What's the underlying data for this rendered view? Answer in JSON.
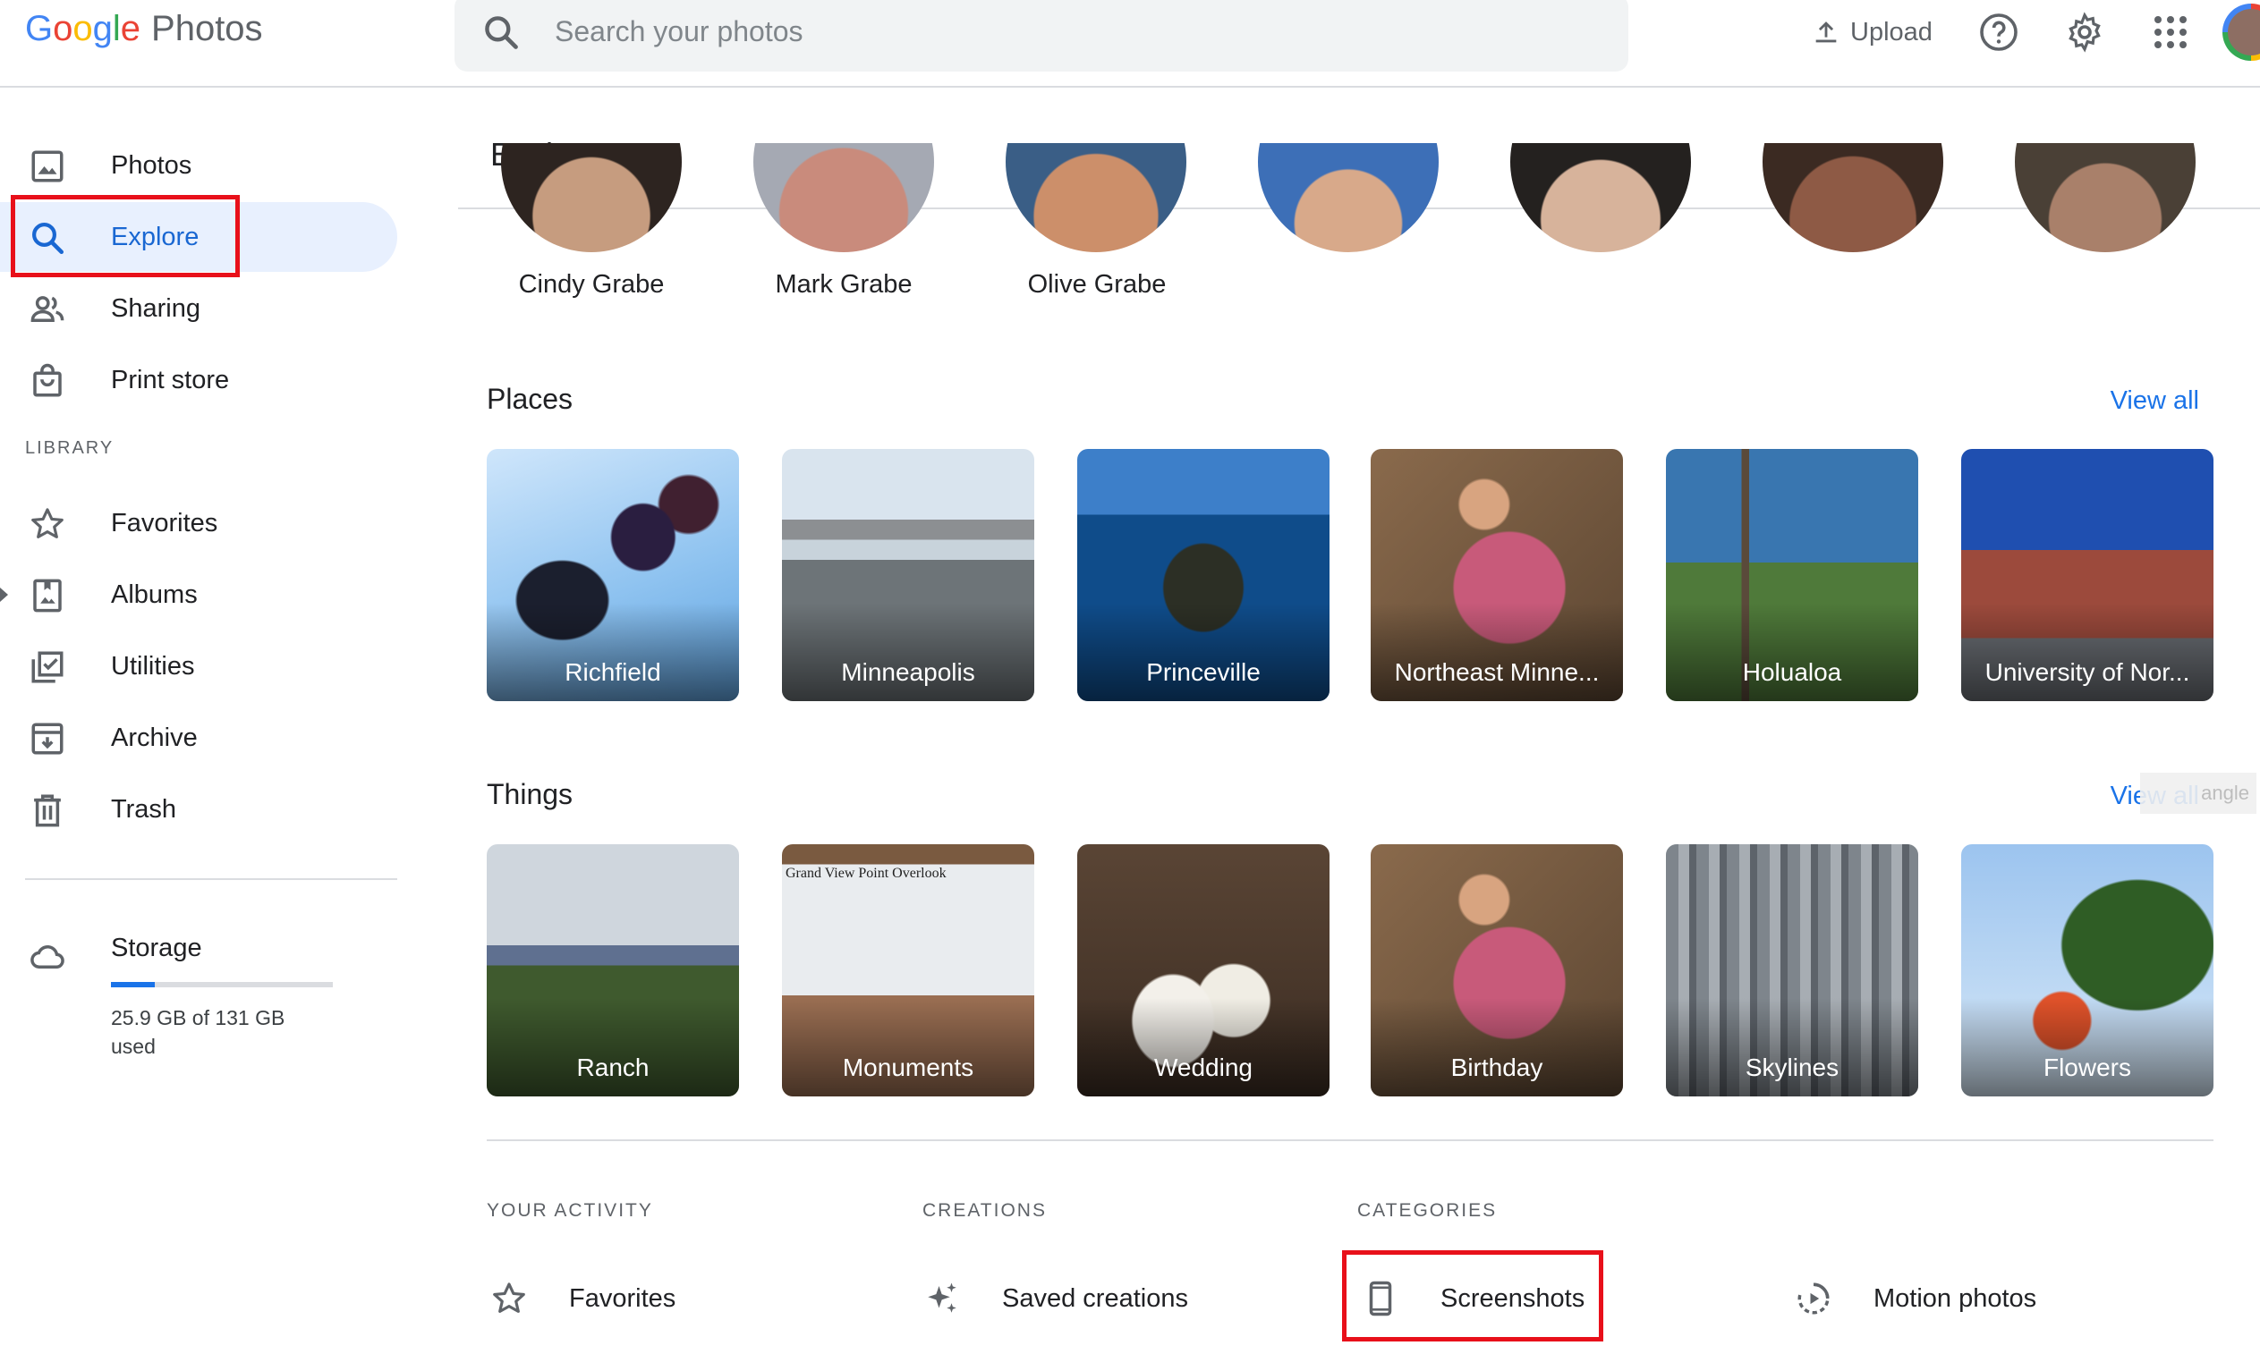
{
  "header": {
    "logo_google": [
      "G",
      "o",
      "o",
      "g",
      "l",
      "e"
    ],
    "logo_product": "Photos",
    "search_placeholder": "Search your photos",
    "upload_label": "Upload"
  },
  "colors": {
    "accent": "#1a73e8",
    "active_bg": "#e8f0fe",
    "highlight_box": "#e8101a"
  },
  "sidebar": {
    "items": [
      {
        "label": "Photos",
        "icon": "photo-icon"
      },
      {
        "label": "Explore",
        "icon": "search-icon",
        "active": true
      },
      {
        "label": "Sharing",
        "icon": "people-icon"
      },
      {
        "label": "Print store",
        "icon": "shopping-bag-icon"
      }
    ],
    "library_label": "LIBRARY",
    "library_items": [
      {
        "label": "Favorites",
        "icon": "star-icon"
      },
      {
        "label": "Albums",
        "icon": "album-icon"
      },
      {
        "label": "Utilities",
        "icon": "utilities-icon"
      },
      {
        "label": "Archive",
        "icon": "archive-icon"
      },
      {
        "label": "Trash",
        "icon": "trash-icon"
      }
    ],
    "storage": {
      "label": "Storage",
      "used_text": "25.9 GB of 131 GB used",
      "used_fraction": 0.198
    }
  },
  "main": {
    "title": "Explore",
    "people": [
      "Cindy Grabe",
      "Mark Grabe",
      "Olive Grabe"
    ],
    "places": {
      "title": "Places",
      "view_all": "View all",
      "tiles": [
        "Richfield",
        "Minneapolis",
        "Princeville",
        "Northeast Minne...",
        "Holualoa",
        "University of Nor..."
      ]
    },
    "things": {
      "title": "Things",
      "view_all": "View all",
      "tiles": [
        "Ranch",
        "Monuments",
        "Wedding",
        "Birthday",
        "Skylines",
        "Flowers"
      ],
      "ghost_text": "angle"
    },
    "monument_caption": "Grand View Point Overlook",
    "your_activity": {
      "title": "YOUR ACTIVITY",
      "item": "Favorites"
    },
    "creations": {
      "title": "CREATIONS",
      "item": "Saved creations"
    },
    "categories": {
      "title": "CATEGORIES",
      "items": [
        "Screenshots",
        "Motion photos"
      ]
    }
  }
}
